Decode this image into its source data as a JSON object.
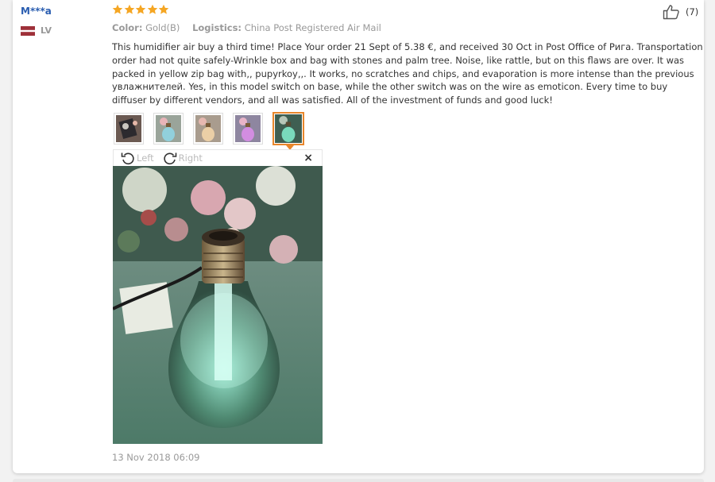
{
  "user": {
    "name": "M***a",
    "country_code": "LV"
  },
  "rating": {
    "stars": 5
  },
  "meta": {
    "color_label": "Color:",
    "color_value": "Gold(B)",
    "logistics_label": "Logistics:",
    "logistics_value": "China Post Registered Air Mail"
  },
  "helpful": {
    "count": "(7)"
  },
  "review": {
    "text": "This humidifier air buy a third time! Place Your order 21 Sept of 5.38 €, and received 30 Oct in Post Office of Рига. Transportation order had not quite safely-Wrinkle box and bag with stones and palm tree. Noise, like rattle, but on this flaws are over. It was packed in yellow zip bag with,, pupyrkoy,,. It works, no scratches and chips, and evaporation is more intense than the previous увлажнителей. Yes, in this model switch on base, while the other switch was on the wire as emoticon. Every time to buy diffuser by different vendors, and all was satisfied. All of the investment of funds and good luck!"
  },
  "viewer": {
    "left_label": "Left",
    "right_label": "Right",
    "close_label": "×"
  },
  "date": "13 Nov 2018 06:09",
  "colors": {
    "star": "#f5a623",
    "name": "#2a5db0",
    "active_thumb_border": "#e8862b",
    "muted": "#999999"
  },
  "icons": [
    "star-icon",
    "thumbs-up-icon",
    "rotate-left-icon",
    "rotate-right-icon",
    "close-icon",
    "flag-latvia-icon"
  ]
}
